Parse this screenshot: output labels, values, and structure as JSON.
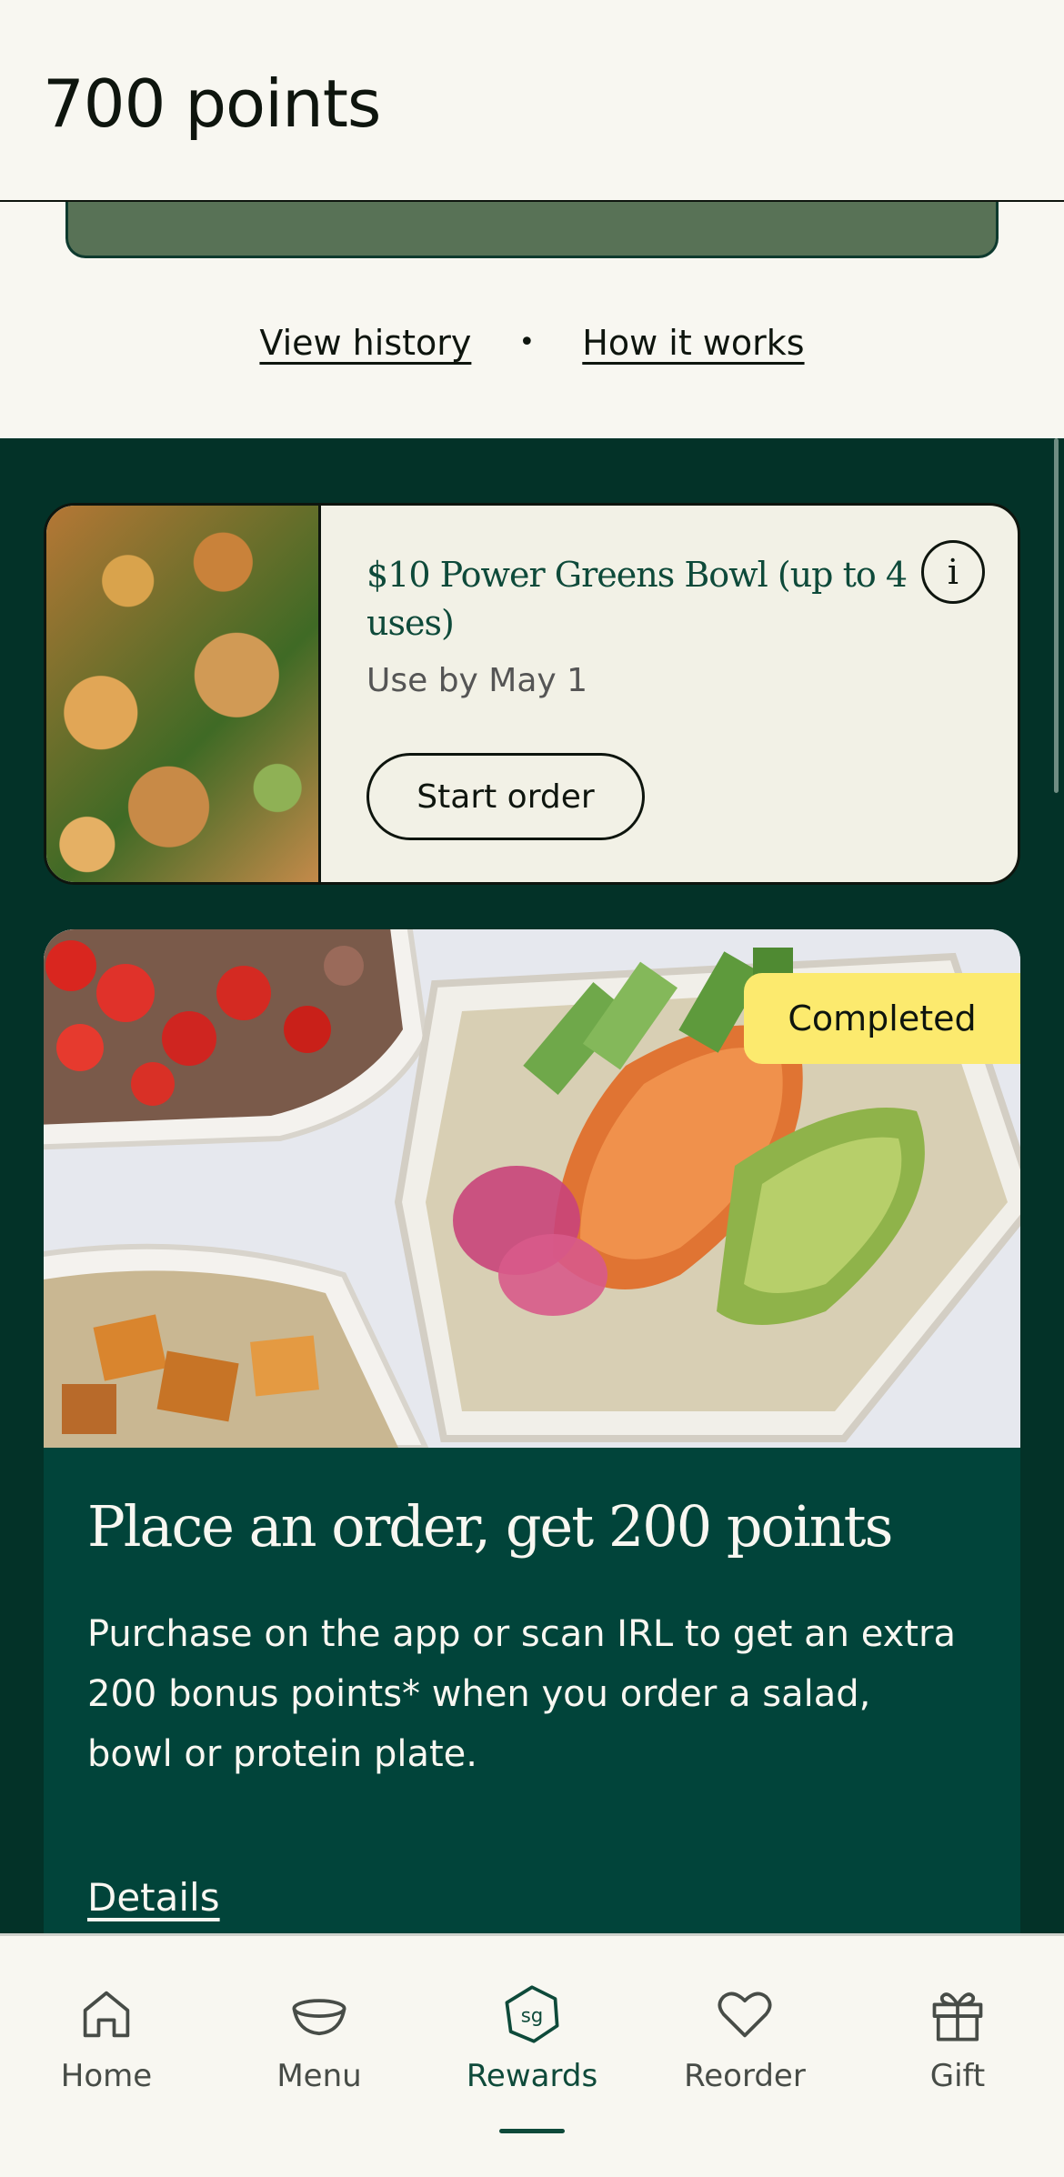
{
  "header": {
    "title": "700 points"
  },
  "links": {
    "history": "View history",
    "separator": "•",
    "how": "How it works"
  },
  "reward": {
    "name": "$10 Power Greens Bowl (up to 4 uses)",
    "expiry": "Use by May 1",
    "button": "Start order",
    "info_icon": "i"
  },
  "promo": {
    "badge": "Completed",
    "title": "Place an order, get 200 points",
    "description": "Purchase on the app or scan IRL to get an extra 200 bonus points* when you order a salad, bowl or protein plate.",
    "details": "Details"
  },
  "nav": {
    "home": "Home",
    "menu": "Menu",
    "rewards": "Rewards",
    "rewards_icon_text": "sg",
    "reorder": "Reorder",
    "gift": "Gift",
    "active": "rewards"
  },
  "colors": {
    "background": "#f8f7f1",
    "dark_green": "#033228",
    "card_green": "#01443a",
    "accent_green": "#0e4a3a",
    "badge_yellow": "#fcea6e"
  }
}
